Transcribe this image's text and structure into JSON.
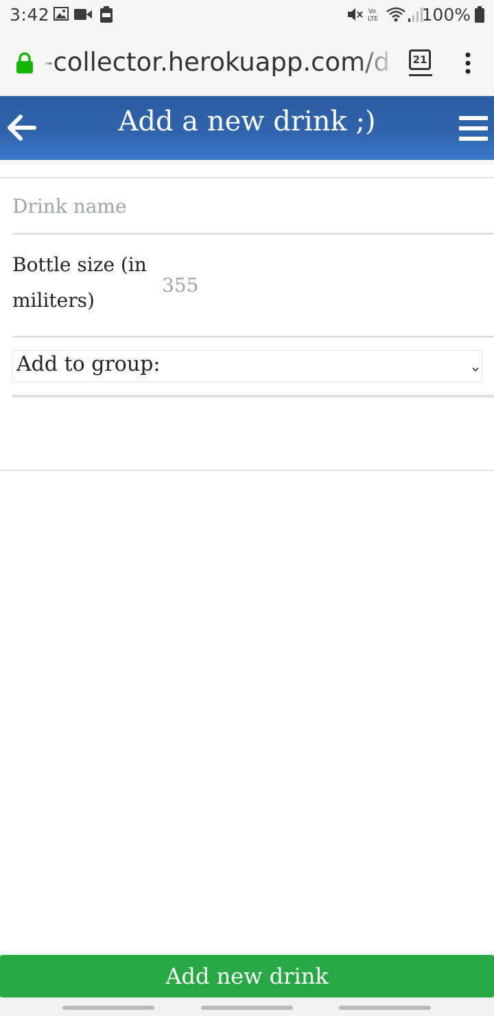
{
  "status_bar": {
    "time": "3:42",
    "battery_percent": "100%",
    "icons": [
      "image-icon",
      "video-icon",
      "battery-saver-icon",
      "mute-icon",
      "volte-icon",
      "wifi-icon",
      "signal-icon",
      "battery-icon"
    ]
  },
  "browser": {
    "url": "-collector.herokuapp.com/d",
    "tab_count": "21",
    "lock_color": "#17b500"
  },
  "header": {
    "title": "Add a new drink ;)",
    "background": "#2f63ab"
  },
  "form": {
    "drink_name_placeholder": "Drink name",
    "bottle_size_label": "Bottle size (in militers)",
    "bottle_size_placeholder": "355",
    "group_select_label": "Add to group:"
  },
  "submit": {
    "label": "Add new drink",
    "color": "#28a745"
  }
}
